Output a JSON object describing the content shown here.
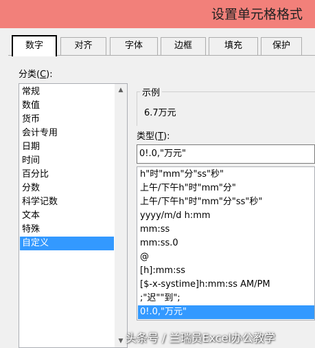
{
  "window": {
    "title": "设置单元格格式",
    "titlebar_color": "#f2807a"
  },
  "tabs": [
    "数字",
    "对齐",
    "字体",
    "边框",
    "填充",
    "保护"
  ],
  "category": {
    "label": "分类",
    "accesskey": "C",
    "items": [
      "常规",
      "数值",
      "货币",
      "会计专用",
      "日期",
      "时间",
      "百分比",
      "分数",
      "科学记数",
      "文本",
      "特殊",
      "自定义"
    ],
    "selected": "自定义"
  },
  "example": {
    "label": "示例",
    "value": "6.7万元"
  },
  "type": {
    "label": "类型",
    "accesskey": "T",
    "value": "0!.0,\"万元\"",
    "items": [
      "h\"时\"mm\"分\"ss\"秒\"",
      "上午/下午h\"时\"mm\"分\"",
      "上午/下午h\"时\"mm\"分\"ss\"秒\"",
      "yyyy/m/d h:mm",
      "mm:ss",
      "mm:ss.0",
      "@",
      "[h]:mm:ss",
      "[$-x-systime]h:mm:ss AM/PM",
      ";\"迟\"\"到\";",
      "0!.0,\"万元\""
    ],
    "selected": "0!.0,\"万元\""
  },
  "watermark": "头条号 / 兰瑞员Excel办公教学",
  "colors": {
    "selection": "#3399ff"
  }
}
